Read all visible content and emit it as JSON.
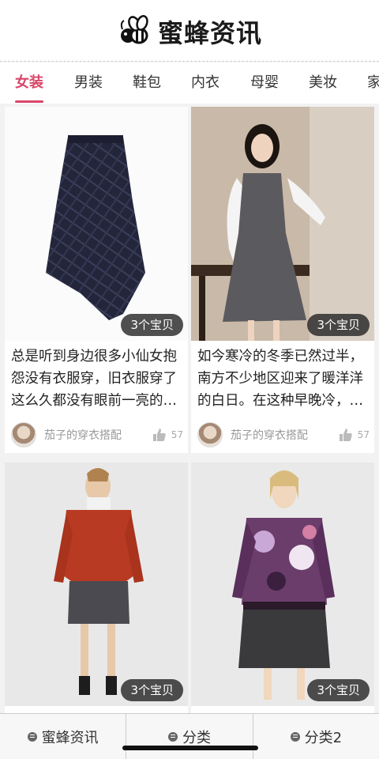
{
  "header": {
    "logo_text": "蜜蜂资讯",
    "logo_icon": "bee-icon"
  },
  "tabs": [
    {
      "label": "女装",
      "active": true
    },
    {
      "label": "男装"
    },
    {
      "label": "鞋包"
    },
    {
      "label": "内衣"
    },
    {
      "label": "母婴"
    },
    {
      "label": "美妆"
    },
    {
      "label": "家"
    }
  ],
  "cards": [
    {
      "badge": "3个宝贝",
      "text": "总是听到身边很多小仙女抱怨没有衣服穿，旧衣服穿了这么久都没有眼前一亮的…",
      "author": "茄子的穿衣搭配",
      "likes": "57",
      "image": "plaid-skirt"
    },
    {
      "badge": "3个宝贝",
      "text": "如今寒冷的冬季已然过半，南方不少地区迎来了暖洋洋的白日。在这种早晚冷，…",
      "author": "茄子的穿衣搭配",
      "likes": "57",
      "image": "grey-pinafore-dress"
    },
    {
      "badge": "3个宝贝",
      "text": "",
      "author": "",
      "likes": "",
      "image": "red-coat-outfit"
    },
    {
      "badge": "3个宝贝",
      "text": "",
      "author": "",
      "likes": "",
      "image": "floral-sweater-outfit"
    }
  ],
  "footer": [
    {
      "label": "蜜蜂资讯",
      "icon": "menu-icon"
    },
    {
      "label": "分类",
      "icon": "menu-icon"
    },
    {
      "label": "分类2",
      "icon": "menu-icon"
    }
  ],
  "colors": {
    "accent": "#d9466b",
    "badge_bg": "#282828"
  }
}
